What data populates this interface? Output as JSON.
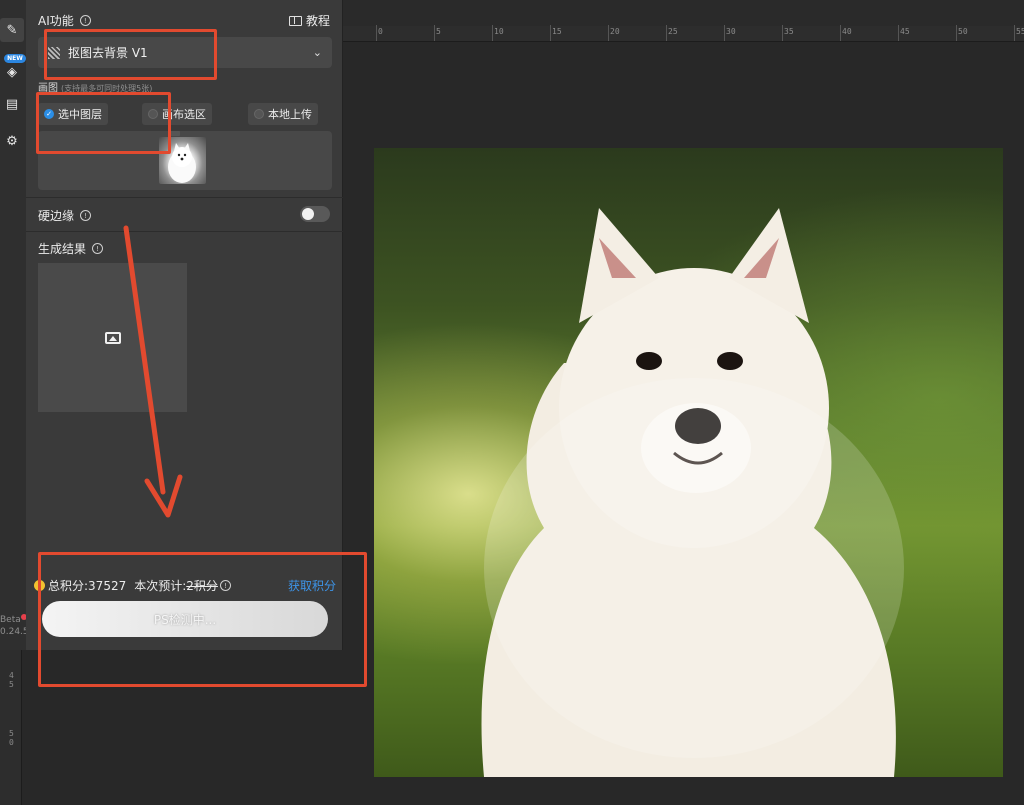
{
  "panel": {
    "ai_title": "AI功能",
    "tutorial_label": "教程",
    "feature_select": "抠图去背景 V1",
    "ref_label": "画图",
    "ref_note": "(支持最多可同时处理5张)",
    "options": [
      "选中图层",
      "画布选区",
      "本地上传"
    ],
    "selected_option": "选中图层",
    "hard_edge_label": "硬边缘",
    "hard_edge_on": false,
    "result_label": "生成结果"
  },
  "credits": {
    "total_label": "总积分:37527",
    "estimate_label": "本次预计:",
    "estimate_value": "2积分",
    "get_credits": "获取积分"
  },
  "action_button": "PS检测中...",
  "toolbar": {
    "badge": "NEW",
    "version_line1": "Beta",
    "version_line2": "0.24.5",
    "icons": [
      "pencil-icon",
      "layers-icon",
      "document-icon",
      "gear-icon"
    ]
  },
  "ruler": {
    "top_labels": [
      "0",
      "5",
      "10",
      "15",
      "20",
      "25",
      "30",
      "35",
      "40",
      "45",
      "50",
      "55"
    ],
    "left_labels": [
      "4",
      "5",
      "5",
      "0"
    ]
  },
  "colors": {
    "accent_blue": "#2b8ee6",
    "annotation_red": "#e24a2f",
    "coin_yellow": "#f2c230",
    "panel_bg": "#3a3a3a"
  }
}
